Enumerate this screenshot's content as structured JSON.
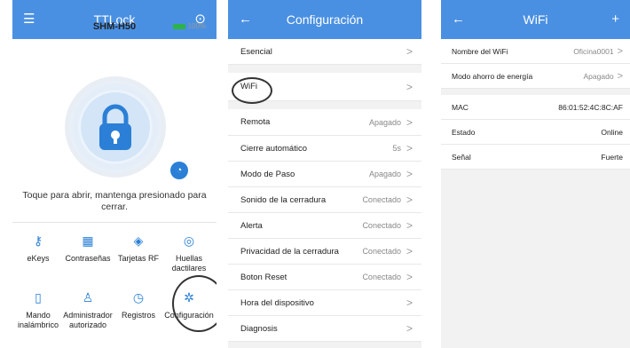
{
  "panel1": {
    "topbar": {
      "title": "TTLock",
      "menu_icon": "hamburger-icon",
      "settings_icon": "target-icon"
    },
    "device_name": "SHM-H50",
    "battery": "100%",
    "hint": "Toque para abrir, mantenga presionado para cerrar.",
    "grid": [
      {
        "label": "eKeys",
        "icon": "key-icon"
      },
      {
        "label": "Contraseñas",
        "icon": "keypad-icon"
      },
      {
        "label": "Tarjetas RF",
        "icon": "card-icon"
      },
      {
        "label": "Huellas dactilares",
        "icon": "fingerprint-icon"
      },
      {
        "label": "Mando inalámbrico",
        "icon": "remote-icon"
      },
      {
        "label": "Administrador autorizado",
        "icon": "admin-icon"
      },
      {
        "label": "Registros",
        "icon": "records-icon"
      },
      {
        "label": "Configuración",
        "icon": "settings-icon"
      }
    ]
  },
  "panel2": {
    "topbar": {
      "title": "Configuración",
      "back": "←"
    },
    "rows": [
      {
        "label": "Esencial",
        "value": ""
      },
      {
        "label": "WiFi",
        "value": ""
      },
      {
        "label": "Remota",
        "value": "Apagado"
      },
      {
        "label": "Cierre automático",
        "value": "5s"
      },
      {
        "label": "Modo de Paso",
        "value": "Apagado"
      },
      {
        "label": "Sonido de la cerradura",
        "value": "Conectado"
      },
      {
        "label": "Alerta",
        "value": "Conectado"
      },
      {
        "label": "Privacidad de la cerradura",
        "value": "Conectado"
      },
      {
        "label": "Boton Reset",
        "value": "Conectado"
      },
      {
        "label": "Hora del dispositivo",
        "value": ""
      },
      {
        "label": "Diagnosis",
        "value": ""
      }
    ]
  },
  "panel3": {
    "topbar": {
      "title": "WiFi",
      "back": "←",
      "add": "+"
    },
    "rows": [
      {
        "label": "Nombre del WiFi",
        "value": "Oficina0001"
      },
      {
        "label": "Modo ahorro de energía",
        "value": "Apagado"
      },
      {
        "label": "MAC",
        "value": "86:01:52:4C:8C:AF"
      },
      {
        "label": "Estado",
        "value": "Online"
      },
      {
        "label": "Señal",
        "value": "Fuerte"
      }
    ]
  }
}
